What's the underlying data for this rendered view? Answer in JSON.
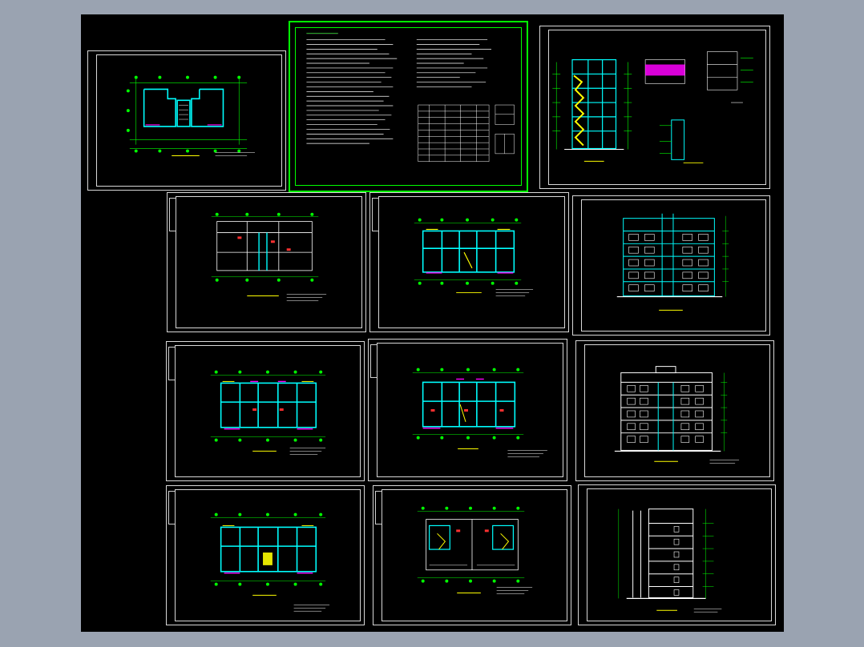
{
  "viewer": {
    "background_color": "#9aa3b1",
    "canvas_color": "#000000"
  },
  "colors": {
    "frame": "#d8d8d8",
    "wall": "#00ffff",
    "grid": "#00ff00",
    "accent_magenta": "#ff00ff",
    "accent_yellow": "#ffff00",
    "accent_red": "#ff3030",
    "text": "#ffffff"
  },
  "sheets": [
    {
      "id": "s1",
      "kind": "plan-small",
      "title": ""
    },
    {
      "id": "s2",
      "kind": "notes",
      "title": ""
    },
    {
      "id": "s3",
      "kind": "section",
      "title": ""
    },
    {
      "id": "s4",
      "kind": "plan-basement",
      "title": ""
    },
    {
      "id": "s5",
      "kind": "plan",
      "title": ""
    },
    {
      "id": "s6",
      "kind": "elevation-front",
      "title": ""
    },
    {
      "id": "s7",
      "kind": "plan",
      "title": ""
    },
    {
      "id": "s8",
      "kind": "plan",
      "title": ""
    },
    {
      "id": "s9",
      "kind": "elevation-rear",
      "title": ""
    },
    {
      "id": "s10",
      "kind": "plan",
      "title": ""
    },
    {
      "id": "s11",
      "kind": "plan-roof",
      "title": ""
    },
    {
      "id": "s12",
      "kind": "elevation-side",
      "title": ""
    }
  ]
}
